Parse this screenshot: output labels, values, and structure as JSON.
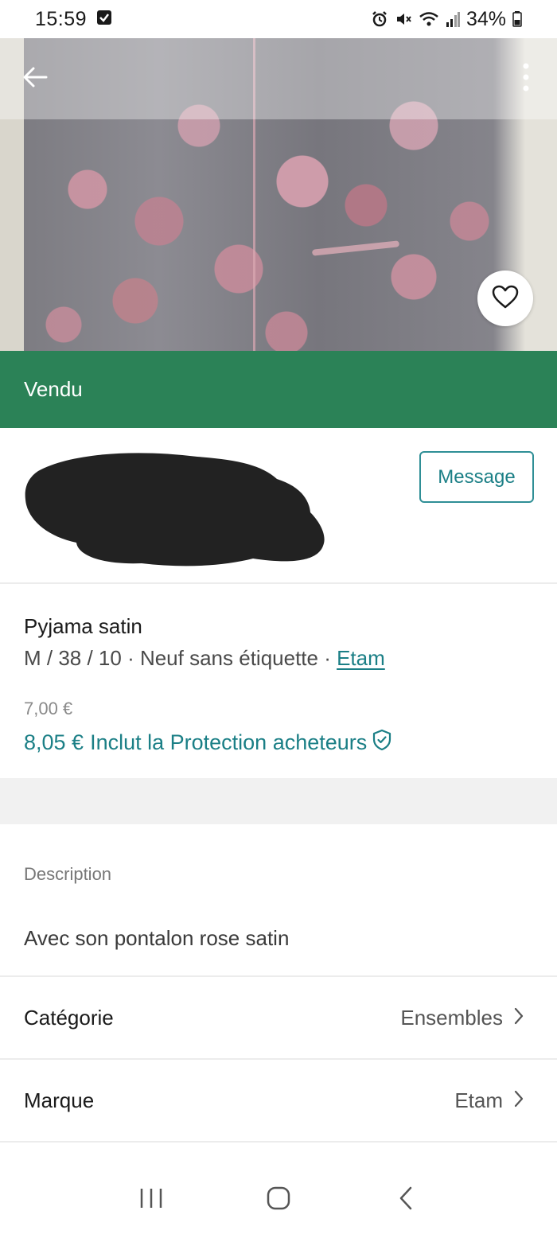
{
  "status_bar": {
    "time": "15:59",
    "battery": "34%",
    "icons": [
      "checkbox-notification-icon",
      "alarm-icon",
      "mute-icon",
      "wifi-icon",
      "signal-icon",
      "battery-icon"
    ]
  },
  "hero": {
    "icons": {
      "back": "arrow-left-icon",
      "more": "more-vertical-icon",
      "favorite": "heart-icon"
    }
  },
  "banner": {
    "label": "Vendu",
    "color": "#2b8257"
  },
  "seller": {
    "message_label": "Message"
  },
  "item": {
    "title": "Pyjama satin",
    "meta_prefix": "M / 38 / 10 · Neuf sans étiquette · ",
    "brand": "Etam",
    "price": "7,00 €",
    "total_price": "8,05 €",
    "protection_label": "Inclut la Protection acheteurs"
  },
  "description": {
    "label": "Description",
    "text": "Avec son pontalon rose satin"
  },
  "attributes": [
    {
      "label": "Catégorie",
      "value": "Ensembles"
    },
    {
      "label": "Marque",
      "value": "Etam"
    }
  ],
  "colors": {
    "accent": "#1b7f86",
    "divider": "#ececec",
    "band": "#f1f1f1"
  }
}
